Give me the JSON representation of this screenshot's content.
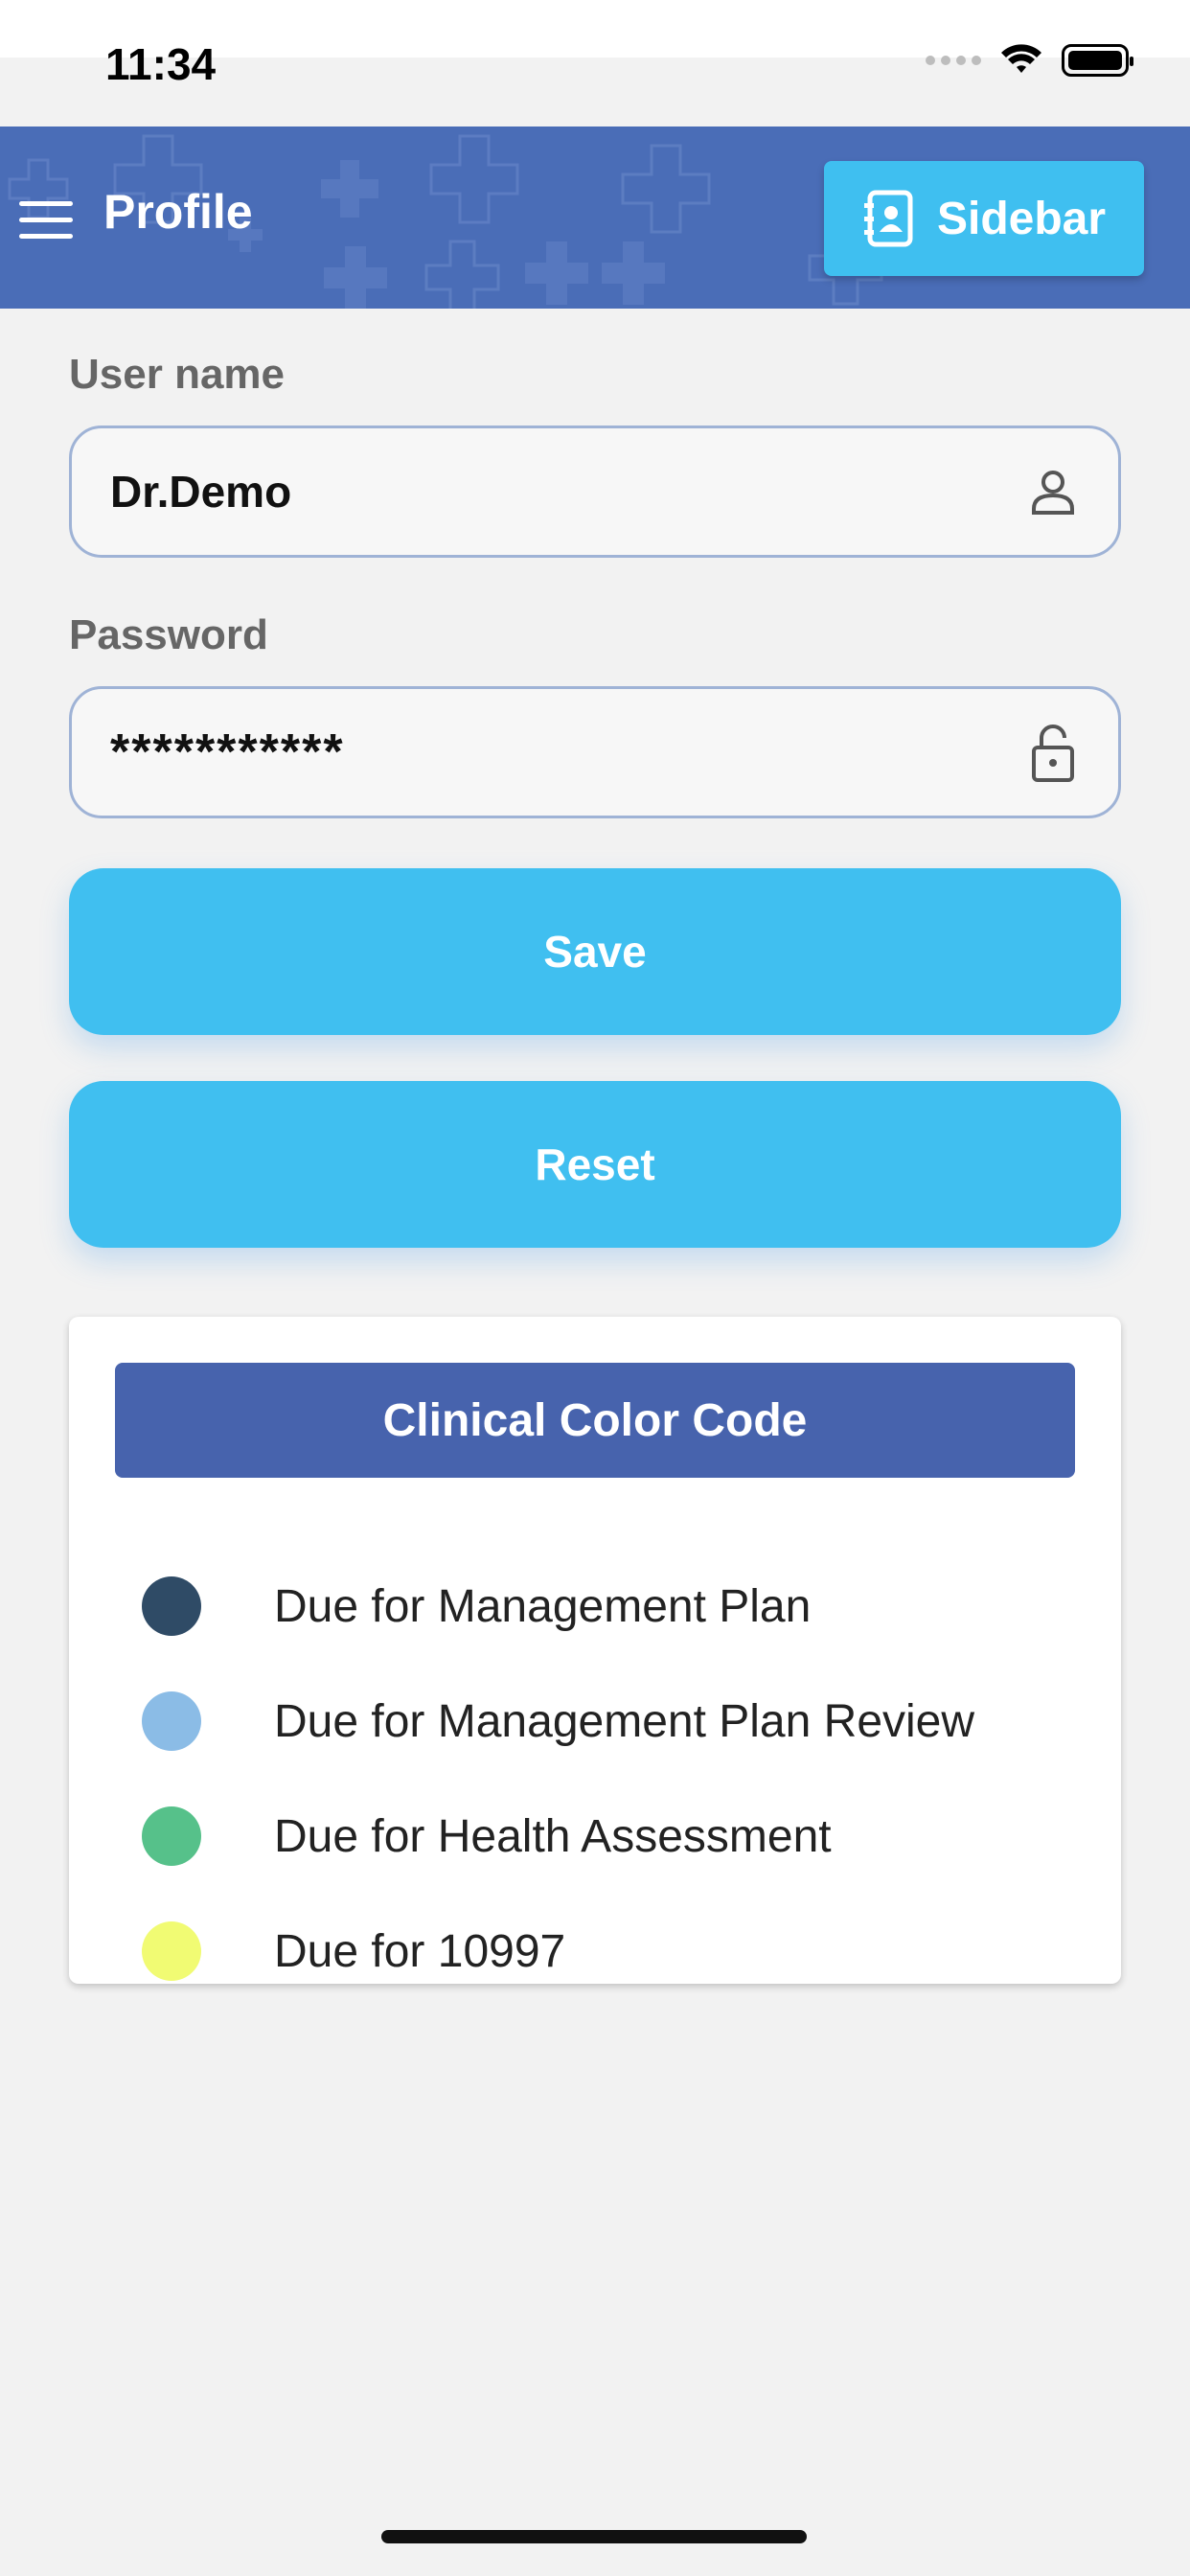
{
  "status_bar": {
    "time": "11:34"
  },
  "header": {
    "title": "Profile",
    "sidebar_label": "Sidebar",
    "bg_color": "#4a6db7",
    "button_color": "#3fbff0"
  },
  "form": {
    "username_label": "User name",
    "username_value": "Dr.Demo",
    "password_label": "Password",
    "password_value": "***********",
    "save_label": "Save",
    "reset_label": "Reset"
  },
  "legend": {
    "title": "Clinical Color Code",
    "items": [
      {
        "label": "Due for Management Plan",
        "color": "#2f4b66"
      },
      {
        "label": "Due for Management Plan Review",
        "color": "#8bbce6"
      },
      {
        "label": "Due for Health Assessment",
        "color": "#56c18a"
      },
      {
        "label": "Due for 10997",
        "color": "#f1fb73"
      }
    ]
  },
  "icons": {
    "menu": "hamburger-icon",
    "sidebar": "contact-book-icon",
    "user": "user-icon",
    "lock": "lock-icon"
  }
}
